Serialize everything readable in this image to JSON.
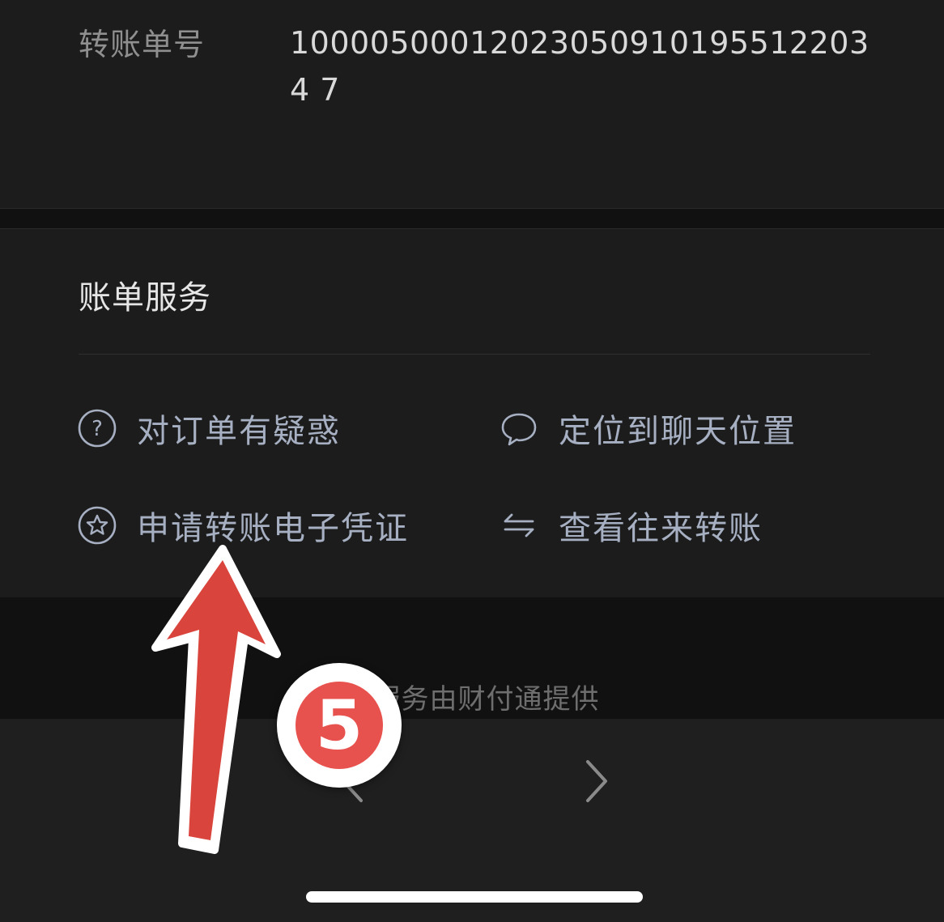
{
  "detail": {
    "label": "转账单号",
    "value": "100005000120230509101955122034 7"
  },
  "services": {
    "title": "账单服务",
    "items": [
      {
        "label": "对订单有疑惑",
        "icon": "question-circle-icon"
      },
      {
        "label": "定位到聊天位置",
        "icon": "chat-bubble-icon"
      },
      {
        "label": "申请转账电子凭证",
        "icon": "star-circle-icon"
      },
      {
        "label": "查看往来转账",
        "icon": "swap-arrows-icon"
      }
    ]
  },
  "footer": {
    "provider": "本服务由财付通提供"
  },
  "navigation": {
    "prev_icon": "chevron-left-icon",
    "next_icon": "chevron-right-icon"
  },
  "annotation": {
    "step_number": "5",
    "arrow_color": "#d9453d",
    "badge_color": "#e8524e"
  }
}
